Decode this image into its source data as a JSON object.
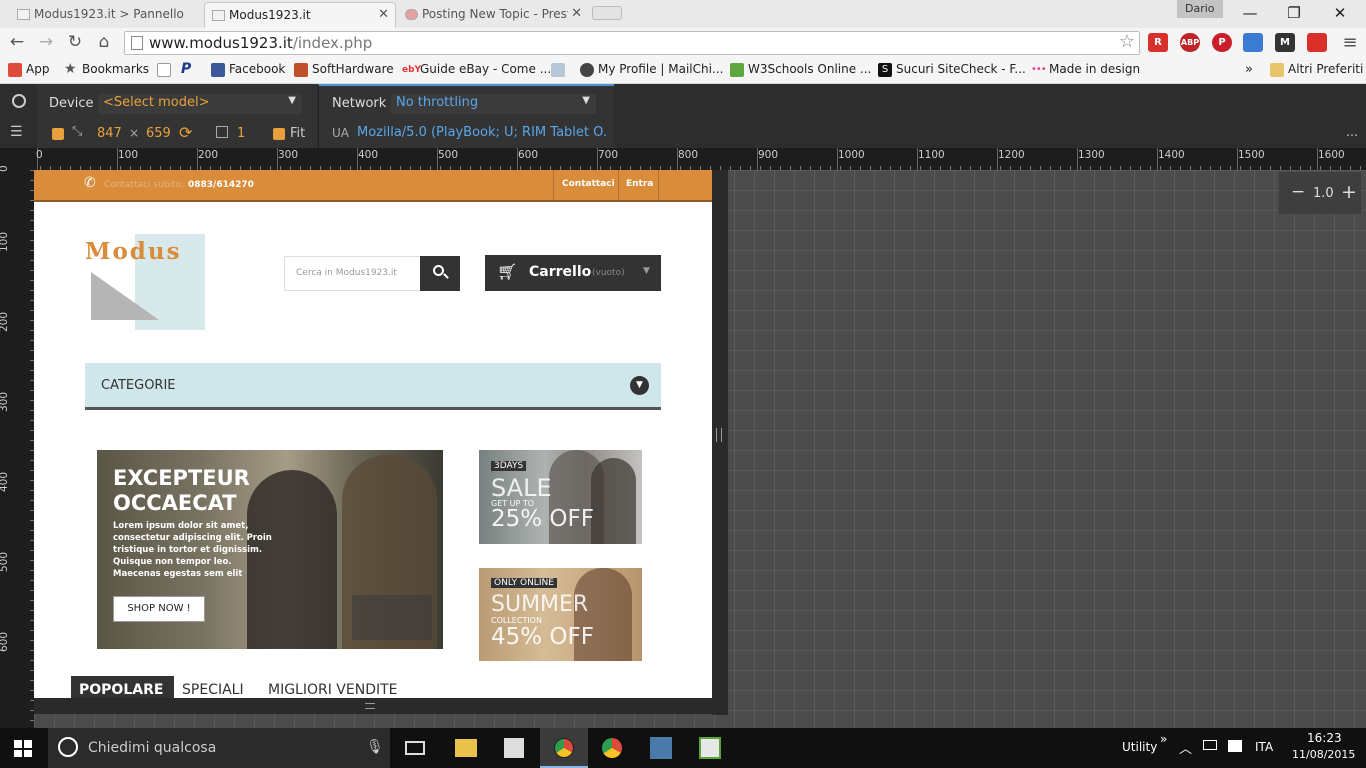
{
  "browser": {
    "tabs": [
      {
        "title": "Modus1923.it > Pannello"
      },
      {
        "title": "Modus1923.it",
        "active": true
      },
      {
        "title": "Posting New Topic - Prest"
      }
    ],
    "profile_name": "Dario",
    "address": {
      "host": "www.modus1923.it",
      "path": "/index.php"
    },
    "extensions": [
      "R",
      "ABP",
      "P",
      "folder",
      "M",
      "Sheets"
    ],
    "bookmarks": [
      {
        "label": "App",
        "icon": "apps-icon",
        "color": "#e04a3a"
      },
      {
        "label": "Bookmarks",
        "icon": "star-icon",
        "color": "#555555"
      },
      {
        "label": "",
        "icon": "page-icon",
        "color": "#ffffff"
      },
      {
        "label": "",
        "icon": "paypal-icon",
        "color": "#1a3a8a"
      },
      {
        "label": "Facebook",
        "icon": "facebook-icon",
        "color": "#3b5998"
      },
      {
        "label": "SoftHardware",
        "icon": "softhardware-icon",
        "color": "#c0502a"
      },
      {
        "label": "Guide eBay - Come ...",
        "icon": "ebay-icon",
        "color": "#e53238"
      },
      {
        "label": "",
        "icon": "image-icon",
        "color": "#b7c7d7"
      },
      {
        "label": "My Profile | MailChi...",
        "icon": "mailchimp-icon",
        "color": "#333333"
      },
      {
        "label": "W3Schools Online ...",
        "icon": "w3schools-icon",
        "color": "#5fa83f"
      },
      {
        "label": "Sucuri SiteCheck - F...",
        "icon": "sucuri-icon",
        "color": "#111111"
      },
      {
        "label": "Made in design",
        "icon": "madeindesign-icon",
        "color": "#e0428a"
      }
    ],
    "bookmarks_more": "»",
    "other_bookmarks": "Altri Preferiti"
  },
  "devtools": {
    "device_label": "Device",
    "device_select": "<Select model>",
    "network_label": "Network",
    "network_select": "No throttling",
    "width": "847",
    "times": "×",
    "height": "659",
    "scale": "1",
    "fit_label": "Fit",
    "ua_label": "UA",
    "ua_value": "Mozilla/5.0 (PlayBook; U; RIM Tablet O...",
    "zoom_value": "1.0",
    "zoom_minus": "−",
    "zoom_plus": "+",
    "ruler_x": [
      "0",
      "100",
      "200",
      "300",
      "400",
      "500",
      "600",
      "700",
      "800",
      "900",
      "1000",
      "1100",
      "1200",
      "1300",
      "1400",
      "1500",
      "1600"
    ],
    "ruler_y": [
      "0",
      "100",
      "200",
      "300",
      "400",
      "500",
      "600"
    ]
  },
  "site": {
    "contact_prefix": "Contattaci subito:",
    "phone": "0883/614270",
    "contact_link": "Contattaci",
    "login_link": "Entra",
    "logo_text": "Modus",
    "search_placeholder": "Cerca in Modus1923.it",
    "cart_label": "Carrello",
    "cart_status": "(vuoto)",
    "categories_label": "CATEGORIE",
    "banner": {
      "title_line1": "EXCEPTEUR",
      "title_line2": "OCCAECAT",
      "body": "Lorem ipsum dolor sit amet, consectetur adipiscing elit. Proin tristique in tortor et dignissim. Quisque non tempor leo. Maecenas egestas sem elit",
      "button": "SHOP NOW !"
    },
    "sale": {
      "tag": "3DAYS",
      "title": "SALE",
      "sub": "GET UP TO",
      "amount": "25% OFF"
    },
    "summer": {
      "tag": "ONLY ONLINE",
      "title": "SUMMER",
      "sub": "COLLECTION",
      "amount": "45% OFF"
    },
    "product_tabs": [
      "POPOLARE",
      "SPECIALI",
      "MIGLIORI VENDITE"
    ]
  },
  "taskbar": {
    "search_placeholder": "Chiedimi qualcosa",
    "utility_label": "Utility",
    "language": "ITA",
    "time": "16:23",
    "date": "11/08/2015"
  }
}
